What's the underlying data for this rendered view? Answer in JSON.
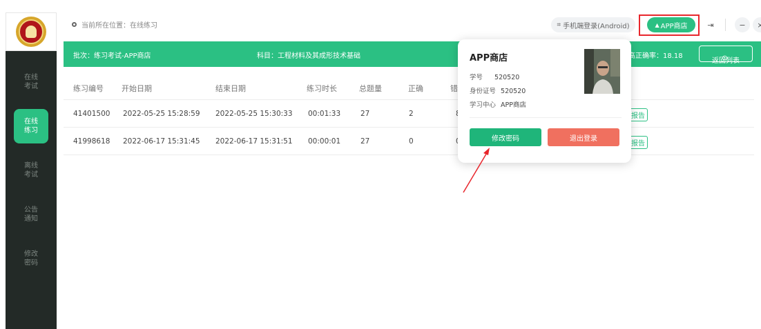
{
  "sidebar": {
    "items": [
      {
        "label": "在线\n考试"
      },
      {
        "label": "在线\n练习"
      },
      {
        "label": "离线\n考试"
      },
      {
        "label": "公告\n通知"
      },
      {
        "label": "修改\n密码"
      }
    ]
  },
  "header": {
    "location": "当前所在位置：在线练习",
    "mobile_login": "手机端登录(Android)",
    "app_store": "APP商店"
  },
  "infobar": {
    "batch": "批次：练习考试-APP商店",
    "subject": "科目：工程材料及其成形技术基础",
    "accuracy": "高正确率：18.18",
    "back": "返回列表"
  },
  "table": {
    "headers": [
      "练习编号",
      "开始日期",
      "结束日期",
      "练习时长",
      "总题量",
      "正确",
      "错"
    ],
    "rows": [
      {
        "id": "41401500",
        "start": "2022-05-25 15:28:59",
        "end": "2022-05-25 15:30:33",
        "duration": "00:01:33",
        "total": "27",
        "correct": "2",
        "wrong": "8",
        "action": "报告"
      },
      {
        "id": "41998618",
        "start": "2022-06-17 15:31:45",
        "end": "2022-06-17 15:31:51",
        "duration": "00:00:01",
        "total": "27",
        "correct": "0",
        "wrong": "0",
        "action": "报告"
      }
    ]
  },
  "popover": {
    "title": "APP商店",
    "student_no_label": "学号",
    "student_no": "520520",
    "id_label": "身份证号",
    "id_value": "520520",
    "center_label": "学习中心",
    "center_value": "APP商店",
    "change_password": "修改密码",
    "logout": "退出登录"
  },
  "colors": {
    "accent": "#2bc083",
    "sidebar_bg": "#232a27",
    "logout_red": "#f0705f",
    "highlight_red": "#e8262c"
  }
}
